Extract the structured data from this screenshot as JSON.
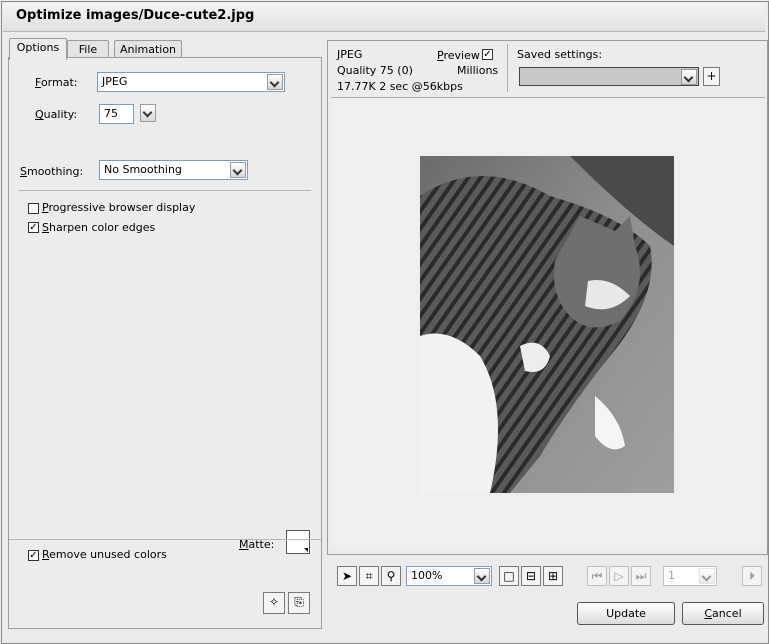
{
  "window": {
    "title": "Optimize images/Duce-cute2.jpg"
  },
  "tabs": [
    {
      "label": "Options",
      "active": true
    },
    {
      "label": "File",
      "active": false
    },
    {
      "label": "Animation",
      "active": false
    }
  ],
  "options": {
    "format_label": "Format:",
    "format_value": "JPEG",
    "quality_label": "Quality:",
    "quality_value": "75",
    "smoothing_label": "Smoothing:",
    "smoothing_value": "No Smoothing",
    "progressive_label": "Progressive browser display",
    "progressive_checked": false,
    "sharpen_label": "Sharpen color edges",
    "sharpen_checked": true,
    "matte_label": "Matte:",
    "remove_unused_label": "Remove unused colors",
    "remove_unused_checked": true
  },
  "info": {
    "format": "JPEG",
    "quality_line": "Quality 75 (0)",
    "size_line": "17.77K  2 sec @56kbps",
    "preview_label": "Preview",
    "preview_checked": true,
    "colors": "Millions",
    "saved_settings_label": "Saved settings:",
    "saved_settings_value": ""
  },
  "toolbar": {
    "zoom_value": "100%",
    "frame_value": "1"
  },
  "buttons": {
    "update": "Update",
    "cancel": "Cancel"
  },
  "colors": {
    "dialog_bg": "#ececec",
    "border": "#9c9c9c"
  },
  "icons": [
    "pointer-icon",
    "crop-icon",
    "zoom-icon",
    "single-view-icon",
    "two-up-view-icon",
    "four-up-view-icon",
    "first-frame-icon",
    "play-icon",
    "last-frame-icon",
    "next-frame-icon",
    "optimize-wizard-icon",
    "export-icon"
  ]
}
